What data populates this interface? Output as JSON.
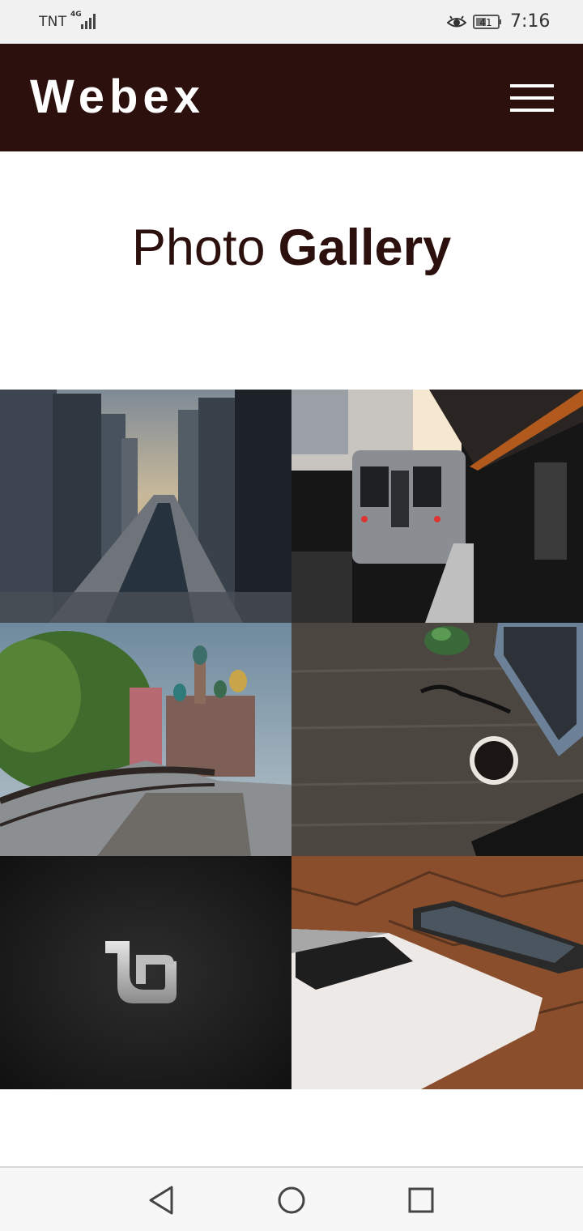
{
  "status_bar": {
    "carrier": "TNT",
    "network": "4G",
    "battery_level": "41",
    "time": "7:16",
    "icons": [
      "signal-icon",
      "eye-icon",
      "battery-icon"
    ]
  },
  "header": {
    "brand": "Webex",
    "menu_icon": "hamburger-menu-icon",
    "background_color": "#2b100d"
  },
  "page": {
    "title_light": "Photo",
    "title_bold": "Gallery"
  },
  "gallery": {
    "photos": [
      {
        "subject": "city-river-skyline"
      },
      {
        "subject": "subway-train-platform"
      },
      {
        "subject": "cathedral-and-bridge"
      },
      {
        "subject": "desk-with-coffee-and-laptop"
      },
      {
        "subject": "linux-mint-logo"
      },
      {
        "subject": "laptop-and-phone-on-pavement"
      }
    ]
  },
  "nav_bar": {
    "buttons": [
      "back-triangle-icon",
      "home-circle-icon",
      "recents-square-icon"
    ]
  }
}
